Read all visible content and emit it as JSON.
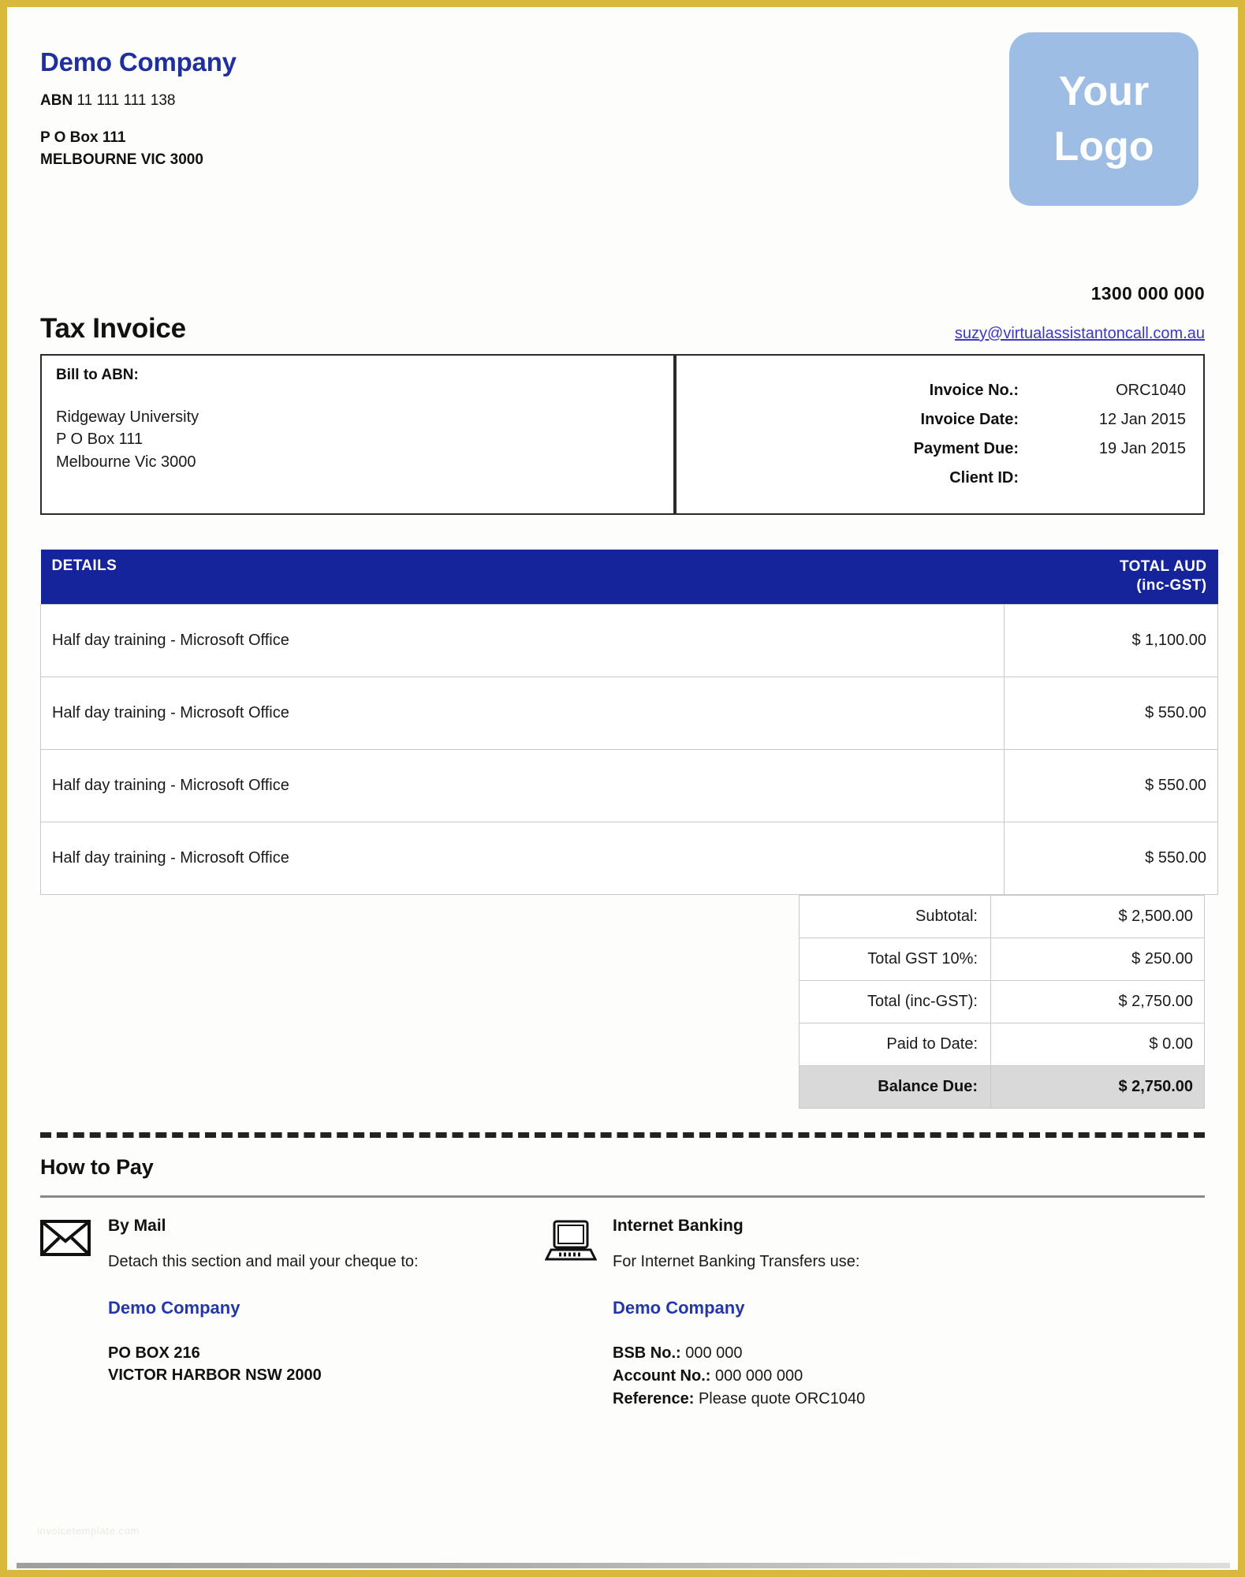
{
  "colors": {
    "frame_gold": "#d9b93c",
    "brand_blue": "#1f2f9e",
    "table_header_blue": "#16249b",
    "logo_blue": "#9dbde4",
    "link_blue": "#3d38c4",
    "balance_row_gray": "#d9d9d9"
  },
  "header": {
    "company_name": "Demo Company",
    "abn_label": "ABN",
    "abn_number": "11 111 111 138",
    "address_line1": "P O Box 111",
    "address_line2": "MELBOURNE VIC 3000",
    "logo_line1": "Your",
    "logo_line2": "Logo"
  },
  "contact": {
    "phone": "1300 000 000",
    "email": "suzy@virtualassistantoncall.com.au"
  },
  "invoice": {
    "title": "Tax Invoice"
  },
  "bill_to": {
    "heading": "Bill to ABN:",
    "line1": "Ridgeway University",
    "line2": "P O Box 111",
    "line3": "Melbourne Vic 3000"
  },
  "details": [
    {
      "label": "Invoice No.:",
      "value": "ORC1040"
    },
    {
      "label": "Invoice Date:",
      "value": "12 Jan 2015"
    },
    {
      "label": "Payment Due:",
      "value": "19 Jan 2015"
    },
    {
      "label": "Client ID:",
      "value": ""
    }
  ],
  "table": {
    "header_details": "DETAILS",
    "header_total_line1": "TOTAL AUD",
    "header_total_line2": "(inc-GST)",
    "rows": [
      {
        "description": "Half day training - Microsoft Office",
        "amount": "$ 1,100.00"
      },
      {
        "description": "Half day training - Microsoft Office",
        "amount": "$ 550.00"
      },
      {
        "description": "Half day training - Microsoft Office",
        "amount": "$ 550.00"
      },
      {
        "description": "Half day training - Microsoft Office",
        "amount": "$ 550.00"
      }
    ]
  },
  "totals": [
    {
      "label": "Subtotal:",
      "value": "$ 2,500.00"
    },
    {
      "label": "Total GST 10%:",
      "value": "$ 250.00"
    },
    {
      "label": "Total (inc-GST):",
      "value": "$ 2,750.00"
    },
    {
      "label": "Paid to Date:",
      "value": "$ 0.00"
    },
    {
      "label": "Balance Due:",
      "value": "$ 2,750.00"
    }
  ],
  "how_to_pay": {
    "section_title": "How to Pay",
    "mail": {
      "heading": "By Mail",
      "instruction": "Detach this section and mail your cheque to:",
      "company": "Demo Company",
      "address_line1": "PO BOX 216",
      "address_line2": "VICTOR HARBOR NSW 2000"
    },
    "internet": {
      "heading": "Internet Banking",
      "instruction": "For Internet Banking Transfers use:",
      "company": "Demo Company",
      "bsb_label": "BSB No.:",
      "bsb_value": "000 000",
      "account_label": "Account No.:",
      "account_value": "000 000 000",
      "reference_label": "Reference:",
      "reference_value": "Please quote ORC1040"
    }
  },
  "watermark": "invoicetemplate.com"
}
